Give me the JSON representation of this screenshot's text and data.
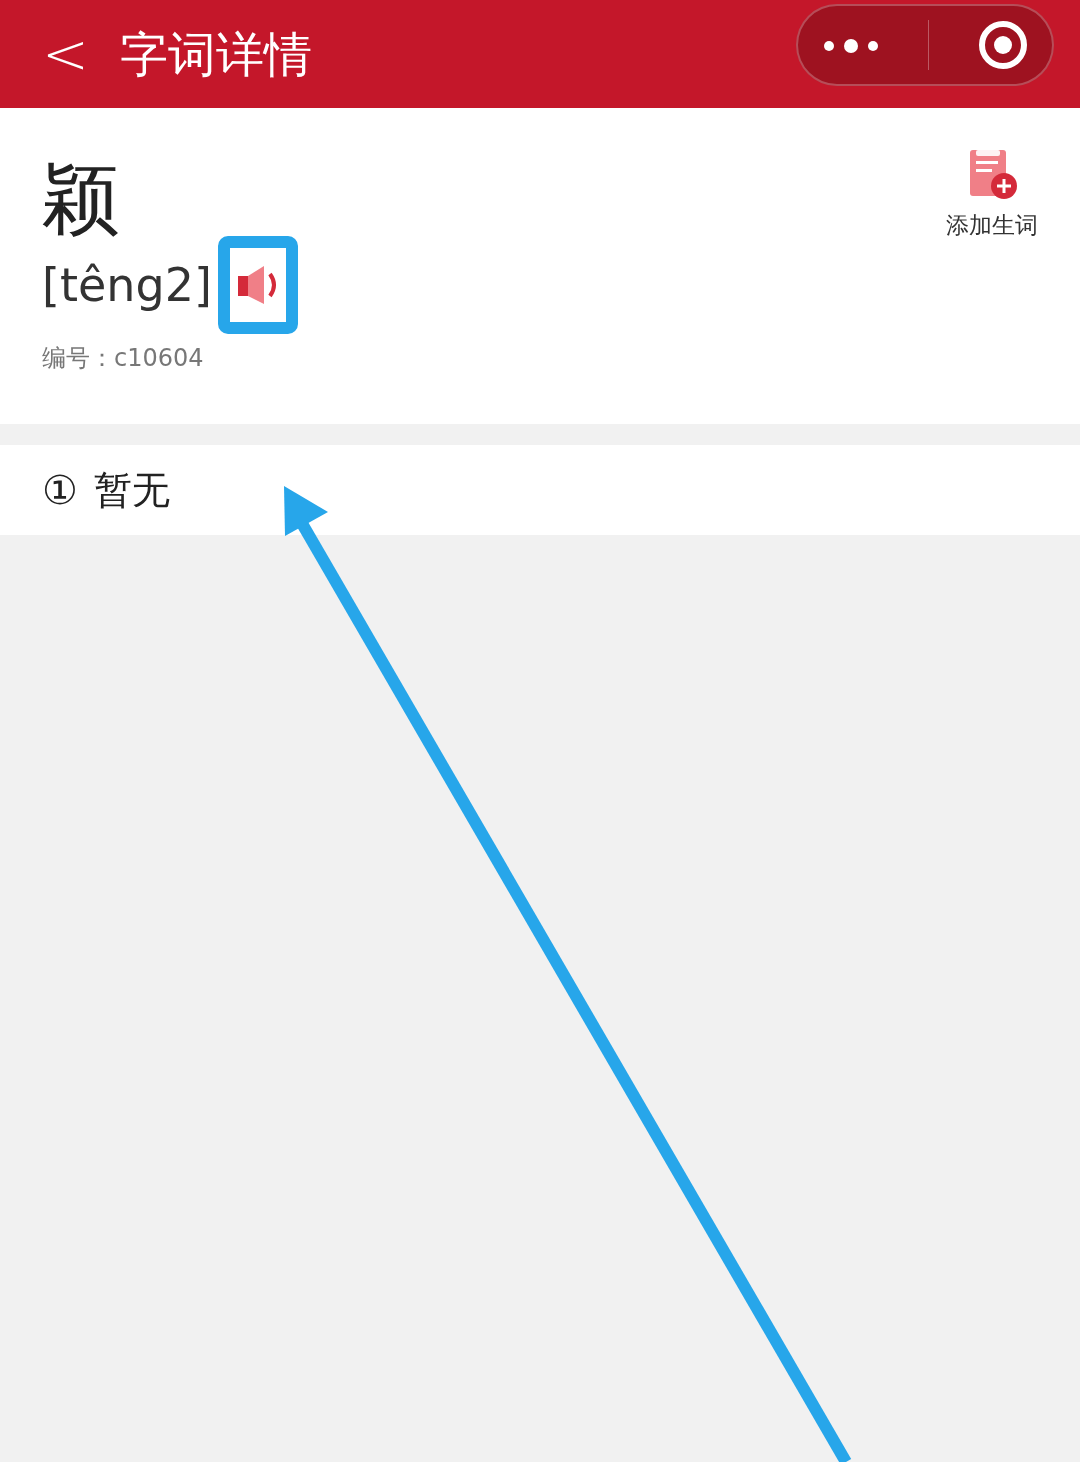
{
  "header": {
    "back": "<",
    "title": "字词详情"
  },
  "word": {
    "character": "颖",
    "pinyin": "[têng2]",
    "code_label": "编号：",
    "code": "c10604"
  },
  "add_button": {
    "label": "添加生词"
  },
  "definitions": [
    {
      "number": "①",
      "text": "暂无"
    }
  ]
}
